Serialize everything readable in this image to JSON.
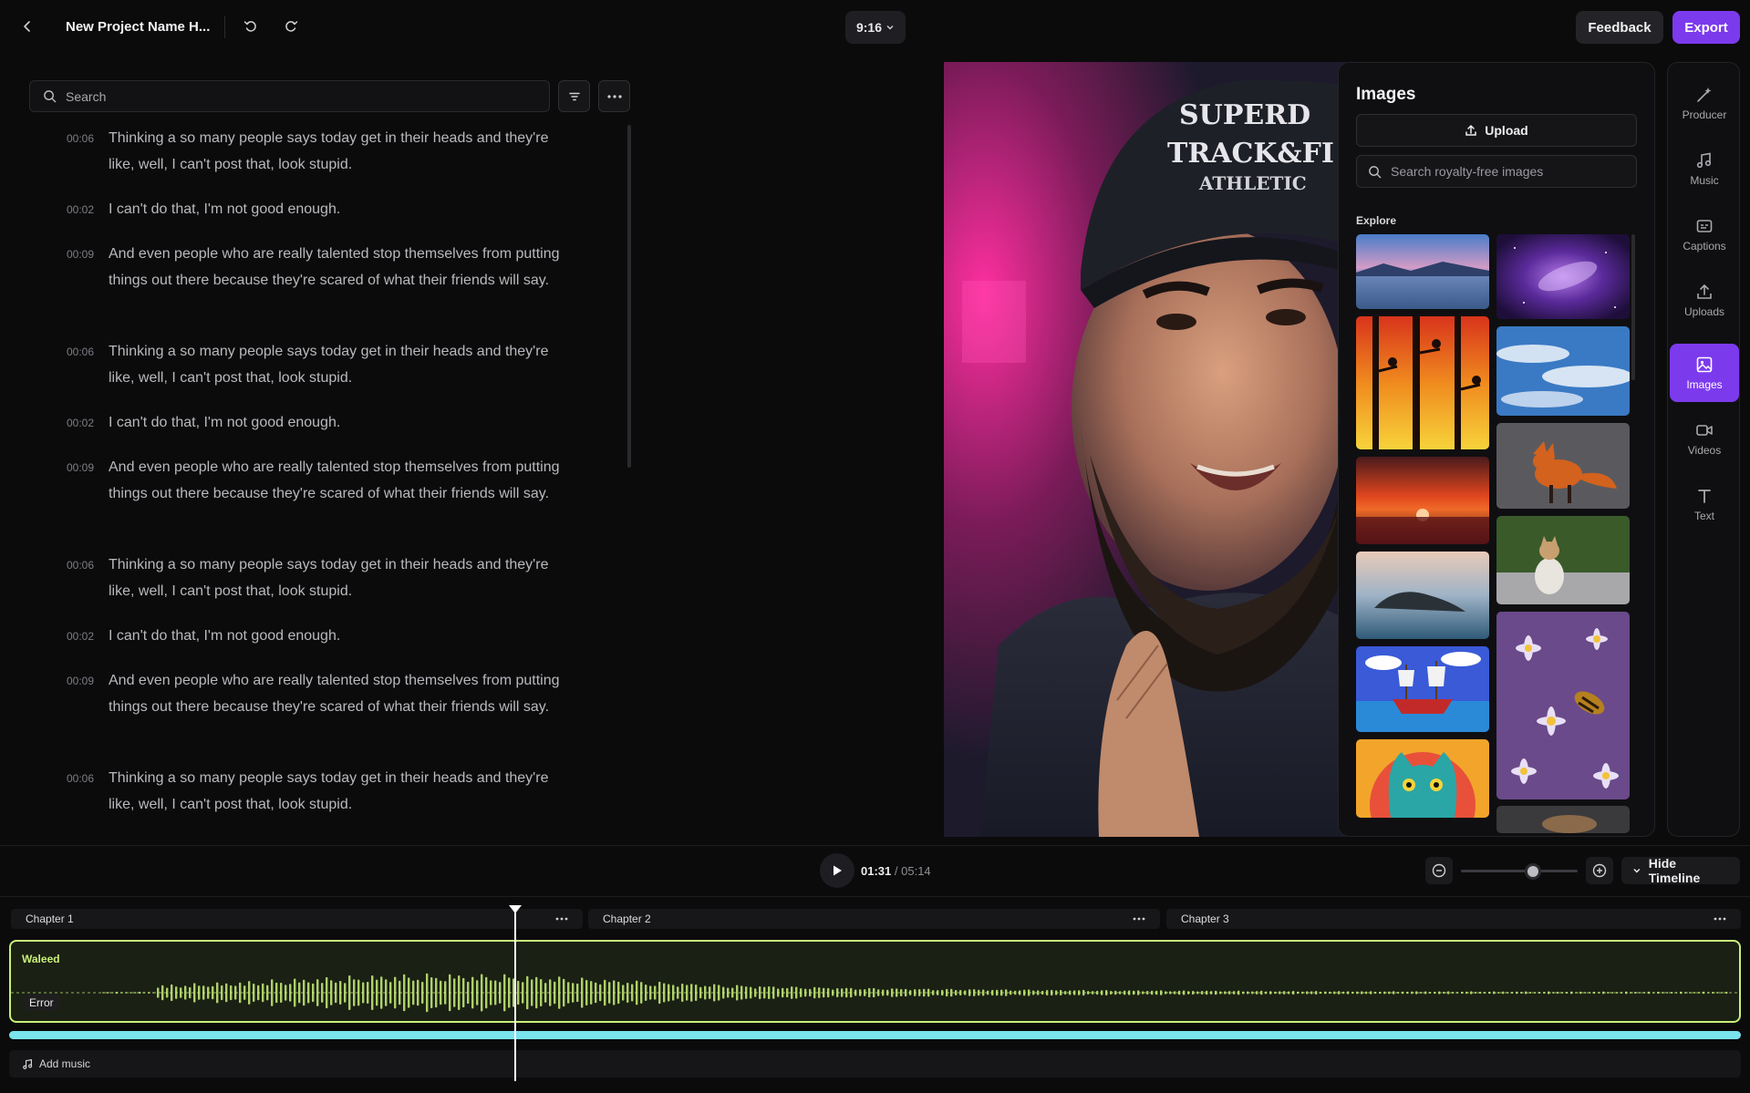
{
  "header": {
    "project_title": "New Project Name H...",
    "aspect_ratio": "9:16",
    "feedback_label": "Feedback",
    "export_label": "Export",
    "accent_color": "#7c3aed"
  },
  "transcript": {
    "search_placeholder": "Search",
    "lines": [
      {
        "time": "00:06",
        "text": "Thinking a so many people says today get in their heads and they're like, well, I can't post that, look stupid."
      },
      {
        "time": "00:02",
        "text": "I can't do that, I'm not good enough."
      },
      {
        "time": "00:09",
        "text": "And even people who are really talented stop themselves from putting things out there because they're scared of what their friends will say."
      },
      {
        "time": "00:06",
        "text": "Thinking a so many people says today get in their heads and they're like, well, I can't post that, look stupid."
      },
      {
        "time": "00:02",
        "text": "I can't do that, I'm not good enough."
      },
      {
        "time": "00:09",
        "text": "And even people who are really talented stop themselves from putting things out there because they're scared of what their friends will say."
      },
      {
        "time": "00:06",
        "text": "Thinking a so many people says today get in their heads and they're like, well, I can't post that, look stupid."
      },
      {
        "time": "00:02",
        "text": "I can't do that, I'm not good enough."
      },
      {
        "time": "00:09",
        "text": "And even people who are really talented stop themselves from putting things out there because they're scared of what their friends will say."
      },
      {
        "time": "00:06",
        "text": "Thinking a so many people says today get in their heads and they're like, well, I can't post that, look stupid."
      }
    ]
  },
  "video": {
    "cap_text_1": "SUPERD",
    "cap_text_2": "TRACK&FI",
    "cap_text_3": "ATHLETIC"
  },
  "images_panel": {
    "title": "Images",
    "upload_label": "Upload",
    "search_placeholder": "Search royalty-free images",
    "explore_label": "Explore",
    "thumbnails": [
      {
        "name": "lake-sunset-thumb"
      },
      {
        "name": "purple-galaxy-thumb"
      },
      {
        "name": "birds-sunset-trees-thumb"
      },
      {
        "name": "blue-sky-clouds-thumb"
      },
      {
        "name": "ocean-sunset-thumb"
      },
      {
        "name": "fox-thumb"
      },
      {
        "name": "island-coast-thumb"
      },
      {
        "name": "cat-sitting-thumb"
      },
      {
        "name": "pirate-ship-cartoon-thumb"
      },
      {
        "name": "bee-on-flowers-thumb"
      },
      {
        "name": "cat-illustration-thumb"
      }
    ]
  },
  "sidebar": {
    "items": [
      {
        "label": "Producer",
        "icon": "magic-wand-icon"
      },
      {
        "label": "Music",
        "icon": "music-note-icon"
      },
      {
        "label": "Captions",
        "icon": "captions-icon"
      },
      {
        "label": "Uploads",
        "icon": "upload-icon"
      },
      {
        "label": "Images",
        "icon": "image-icon",
        "active": true
      },
      {
        "label": "Videos",
        "icon": "video-camera-icon"
      },
      {
        "label": "Text",
        "icon": "text-icon"
      }
    ]
  },
  "transport": {
    "current_time": "01:31",
    "separator": "/",
    "total_time": "05:14",
    "zoom_level": 0.62,
    "hide_timeline_label": "Hide Timeline"
  },
  "timeline": {
    "chapters": [
      {
        "label": "Chapter 1"
      },
      {
        "label": "Chapter 2"
      },
      {
        "label": "Chapter 3"
      }
    ],
    "track_name": "Waleed",
    "error_label": "Error",
    "track_color": "#c8f07a",
    "progress_color": "#79e3ee",
    "add_music_label": "Add music"
  }
}
